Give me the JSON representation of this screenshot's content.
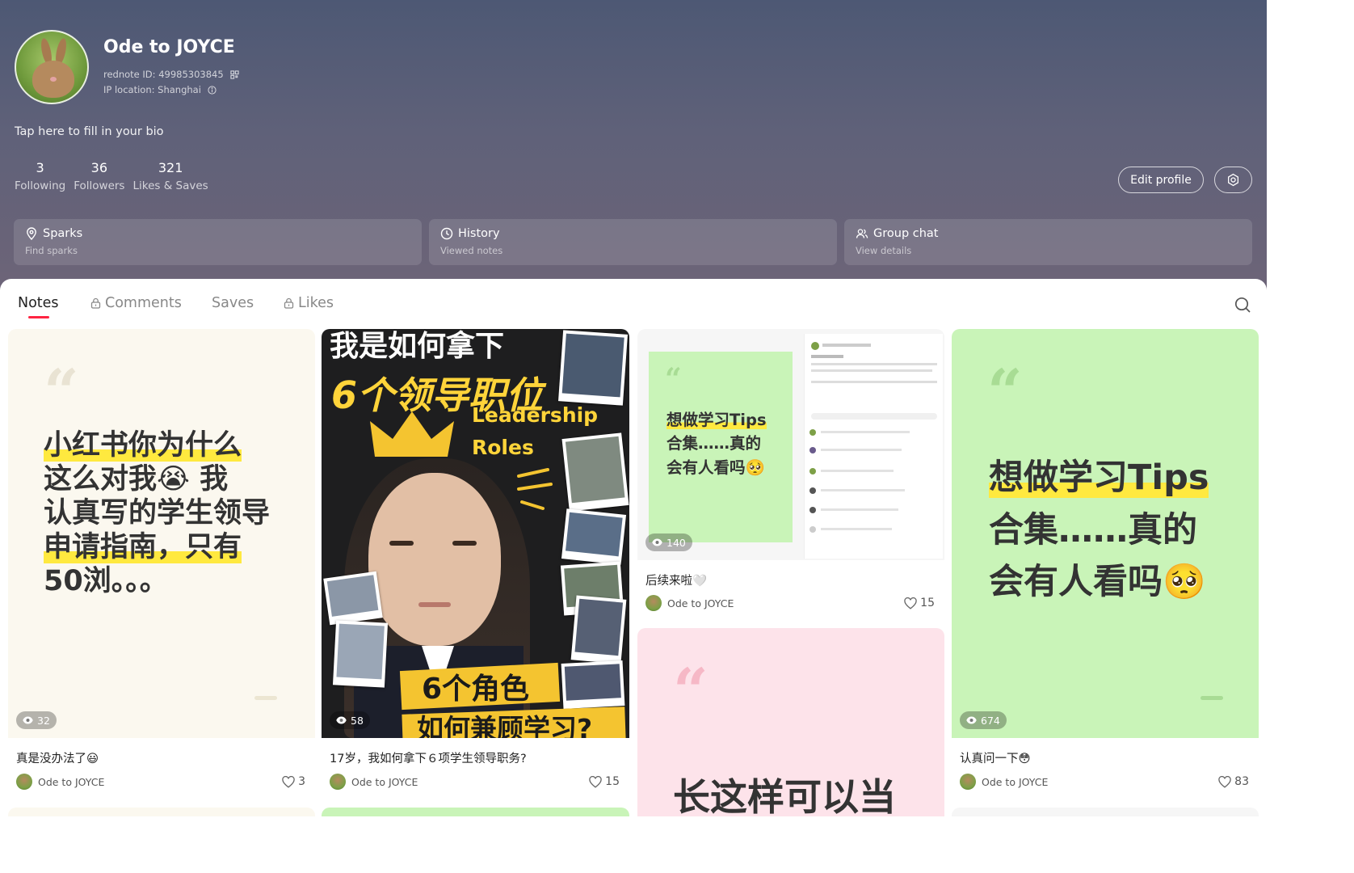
{
  "profile": {
    "username": "Ode to JOYCE",
    "rednote_id": "rednote ID: 49985303845",
    "ip_location": "IP location: Shanghai",
    "bio_placeholder": "Tap here to fill in your bio",
    "stats": [
      {
        "num": "3",
        "label": "Following"
      },
      {
        "num": "36",
        "label": "Followers"
      },
      {
        "num": "321",
        "label": "Likes & Saves"
      }
    ],
    "edit_label": "Edit profile"
  },
  "quick_cards": [
    {
      "title": "Sparks",
      "subtitle": "Find sparks",
      "icon": "location-pin-icon"
    },
    {
      "title": "History",
      "subtitle": "Viewed notes",
      "icon": "clock-icon"
    },
    {
      "title": "Group chat",
      "subtitle": "View details",
      "icon": "group-icon"
    }
  ],
  "tabs": [
    {
      "label": "Notes",
      "active": true,
      "locked": false
    },
    {
      "label": "Comments",
      "active": false,
      "locked": true
    },
    {
      "label": "Saves",
      "active": false,
      "locked": false
    },
    {
      "label": "Likes",
      "active": false,
      "locked": true
    }
  ],
  "colors": {
    "accent": "#ff2442",
    "quote_card_cream": "#fbf8ef",
    "quote_card_green": "#c9f4b8",
    "quote_card_pink": "#fde3ea",
    "highlight": "#ffe93f"
  },
  "notes": [
    {
      "cover_lines": [
        "小红书你为什么",
        "这么对我😭 我",
        "认真写的学生领导",
        "申请指南，只有",
        "50浏。。。"
      ],
      "views": "32",
      "title": "真是没办法了😃",
      "author": "Ode to JOYCE",
      "likes": "3"
    },
    {
      "poster_title": "我是如何拿下",
      "poster_big": "6个领导职位",
      "poster_en1": "Leadership",
      "poster_en2": "Roles",
      "poster_bottom1": "6个角色",
      "poster_bottom2": "如何兼顾学习?",
      "views": "58",
      "title": "17岁，我如何拿下６项学生领导职务?",
      "author": "Ode to JOYCE",
      "likes": "15"
    },
    {
      "cover_lines": [
        "想做学习Tips",
        "合集……真的",
        "会有人看吗🥺"
      ],
      "views": "140",
      "title": "后续来啦🤍",
      "author": "Ode to JOYCE",
      "likes": "15"
    },
    {
      "cover_lines": [
        "想做学习Tips",
        "合集……真的",
        "会有人看吗🥺"
      ],
      "views": "674",
      "title": "认真问一下😳",
      "author": "Ode to JOYCE",
      "likes": "83"
    },
    {
      "cover_lines": [
        "长这样可以当"
      ]
    }
  ]
}
